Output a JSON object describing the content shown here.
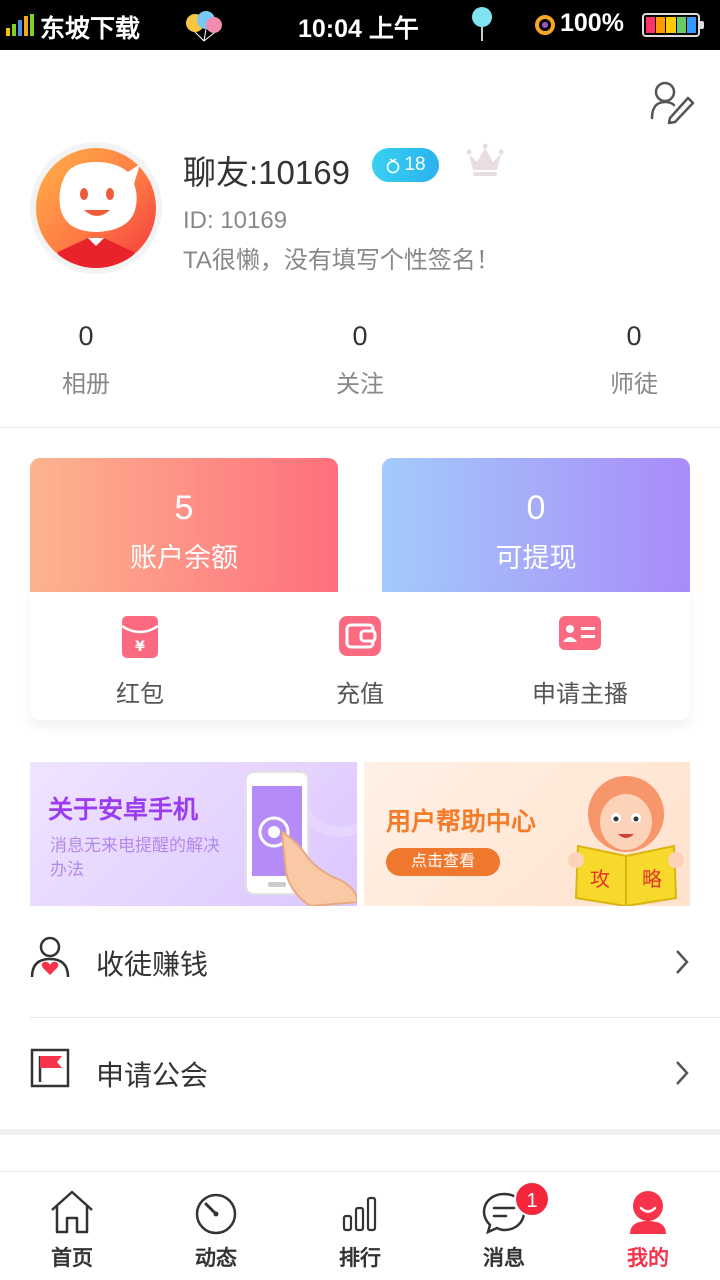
{
  "status_bar": {
    "carrier": "东坡下载",
    "time": "10:04 上午",
    "battery": "100%"
  },
  "profile": {
    "nickname": "聊友:10169",
    "level": "18",
    "id_text": "ID: 10169",
    "signature": "TA很懒，没有填写个性签名！"
  },
  "stats": [
    {
      "value": "0",
      "label": "相册"
    },
    {
      "value": "0",
      "label": "关注"
    },
    {
      "value": "0",
      "label": "师徒"
    }
  ],
  "wallet": {
    "balance": {
      "value": "5",
      "label": "账户余额"
    },
    "withdraw": {
      "value": "0",
      "label": "可提现"
    }
  },
  "actions": [
    {
      "label": "红包",
      "icon": "red-envelope-icon"
    },
    {
      "label": "充值",
      "icon": "wallet-icon"
    },
    {
      "label": "申请主播",
      "icon": "id-card-icon"
    }
  ],
  "banners": {
    "android": {
      "title": "关于安卓手机",
      "subtitle": "消息无来电提醒的解决办法"
    },
    "help": {
      "title": "用户帮助中心",
      "button": "点击查看",
      "book_left": "攻",
      "book_right": "略"
    }
  },
  "menu": [
    {
      "label": "收徒赚钱",
      "icon": "apprentice-icon"
    },
    {
      "label": "申请公会",
      "icon": "flag-icon"
    }
  ],
  "tabs": [
    {
      "label": "首页",
      "icon": "home-icon"
    },
    {
      "label": "动态",
      "icon": "compass-icon"
    },
    {
      "label": "排行",
      "icon": "bar-chart-icon"
    },
    {
      "label": "消息",
      "icon": "message-icon",
      "badge": "1"
    },
    {
      "label": "我的",
      "icon": "profile-icon",
      "active": true
    }
  ],
  "colors": {
    "accent": "#f6334b",
    "balance_gradient": [
      "#fcb48f",
      "#ff6f7d"
    ],
    "withdraw_gradient": [
      "#a3cbfb",
      "#a98bf9"
    ]
  }
}
